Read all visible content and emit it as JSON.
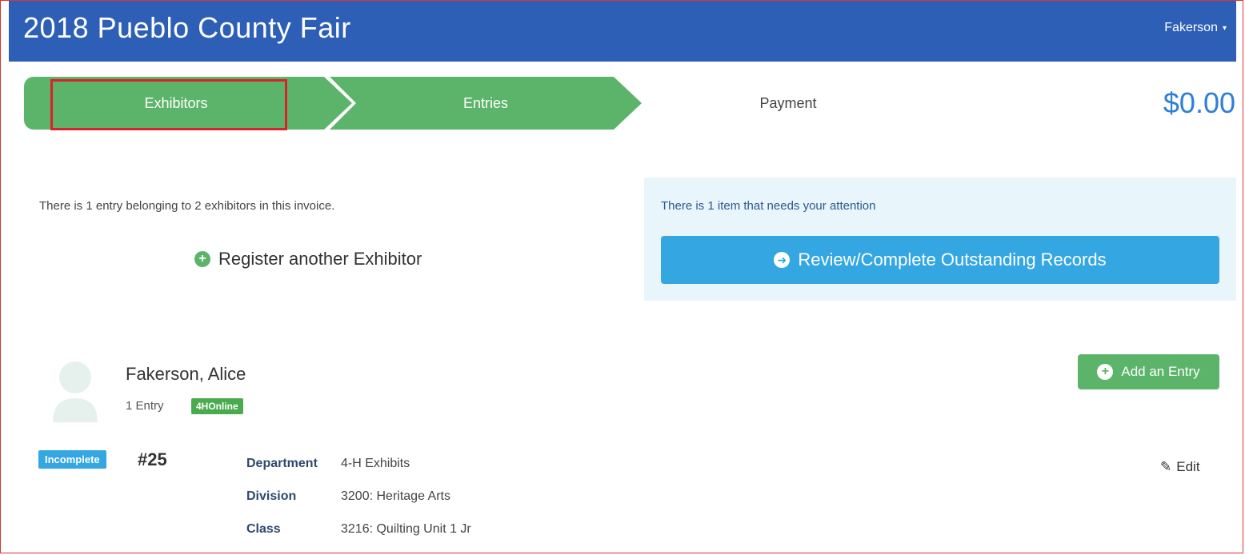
{
  "header": {
    "title": "2018 Pueblo County Fair",
    "user": "Fakerson",
    "brand_color": "#2e5fb6"
  },
  "steps": [
    {
      "label": "Exhibitors",
      "state": "active"
    },
    {
      "label": "Entries",
      "state": "complete"
    },
    {
      "label": "Payment",
      "state": "pending"
    }
  ],
  "invoice_total": "$0.00",
  "summary": {
    "text": "There is 1 entry belonging to 2 exhibitors in this invoice.",
    "register_label": "Register another Exhibitor"
  },
  "attention": {
    "text": "There is 1 item that needs your attention",
    "button_label": "Review/Complete Outstanding Records"
  },
  "exhibitor": {
    "name": "Fakerson, Alice",
    "entry_count": "1 Entry",
    "badge": "4HOnline",
    "add_entry_label": "Add an Entry"
  },
  "entry": {
    "status": "Incomplete",
    "number": "#25",
    "edit_label": "Edit",
    "fields": [
      {
        "label": "Department",
        "value": "4-H Exhibits"
      },
      {
        "label": "Division",
        "value": "3200: Heritage Arts"
      },
      {
        "label": "Class",
        "value": "3216: Quilting Unit 1 Jr"
      }
    ]
  }
}
